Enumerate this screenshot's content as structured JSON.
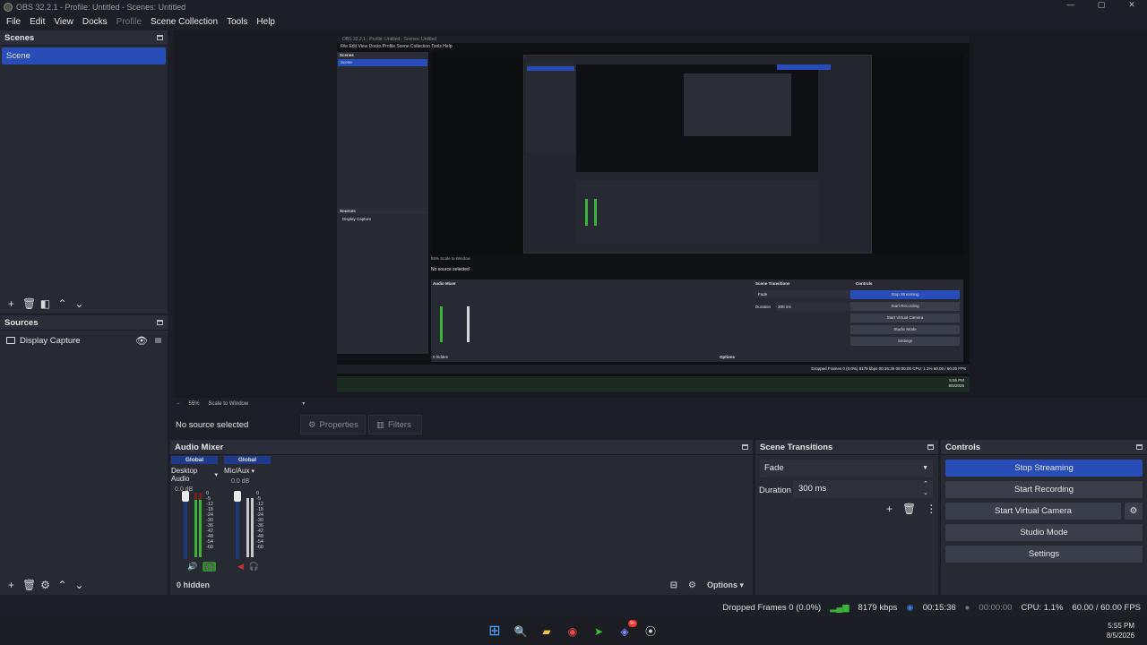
{
  "window": {
    "title": "OBS 32.2.1 - Profile: Untitled - Scenes: Untitled",
    "min": "—",
    "max": "▢",
    "close": "✕"
  },
  "menu": [
    "File",
    "Edit",
    "View",
    "Docks",
    "Profile",
    "Scene Collection",
    "Tools",
    "Help"
  ],
  "scenes": {
    "title": "Scenes",
    "items": [
      "Scene"
    ]
  },
  "sources": {
    "title": "Sources",
    "items": [
      "Display Capture"
    ]
  },
  "preview": {
    "zoom": "55%",
    "scale_mode": "Scale to Window",
    "inner_title": "OBS 32.2.1 - Profile: Untitled - Scenes: Untitled",
    "inner_menu": "File   Edit   View   Docks   Profile   Scene Collection   Tools   Help",
    "inner_scenes": "Scenes",
    "inner_scene": "Scene",
    "inner_sources": "Sources",
    "inner_source": "Display Capture",
    "inner_nosel": "No source selected",
    "inner_audio": "Audio Mixer",
    "inner_trans": "Scene Transitions",
    "inner_controls": "Controls",
    "inner_stop": "Stop Streaming",
    "inner_rec": "Start Recording",
    "inner_vcam": "Start Virtual Camera",
    "inner_studio": "Studio Mode",
    "inner_settings": "Settings",
    "inner_fade": "Fade",
    "inner_duration": "Duration",
    "inner_dur_val": "300 ms",
    "inner_hidden": "0 hidden",
    "inner_options": "Options",
    "inner_status": "Dropped Frames 0 (0.0%)   8179 kbps   00:15:36   00:00:00   CPU: 1.1%   60.00 / 60.00 FPS",
    "inner_clock": "5:55 PM",
    "inner_date": "8/5/2026"
  },
  "context": {
    "no_selection": "No source selected",
    "properties": "Properties",
    "filters": "Filters"
  },
  "audio": {
    "title": "Audio Mixer",
    "channels": [
      {
        "global": "Global",
        "name": "Desktop Audio",
        "db": "0.0 dB"
      },
      {
        "global": "Global",
        "name": "Mic/Aux",
        "db": "0.0 dB"
      }
    ],
    "scale": [
      "0",
      "-5",
      "-12",
      "-18",
      "-24",
      "-30",
      "-36",
      "-42",
      "-48",
      "-54",
      "-60"
    ],
    "hidden": "0 hidden",
    "options": "Options"
  },
  "transitions": {
    "title": "Scene Transitions",
    "selected": "Fade",
    "duration_label": "Duration",
    "duration_value": "300 ms"
  },
  "controls": {
    "title": "Controls",
    "stop_streaming": "Stop Streaming",
    "start_recording": "Start Recording",
    "start_vcam": "Start Virtual Camera",
    "studio_mode": "Studio Mode",
    "settings": "Settings"
  },
  "status": {
    "dropped": "Dropped Frames 0 (0.0%)",
    "kbps": "8179 kbps",
    "stream_time": "00:15:36",
    "rec_time": "00:00:00",
    "cpu": "CPU: 1.1%",
    "fps": "60.00 / 60.00 FPS"
  },
  "taskbar": {
    "time": "5:55 PM",
    "date": "8/5/2026",
    "badge": "9+"
  },
  "colors": {
    "accent": "#284cb8",
    "panel": "#272a33",
    "background": "#1d1f26"
  }
}
